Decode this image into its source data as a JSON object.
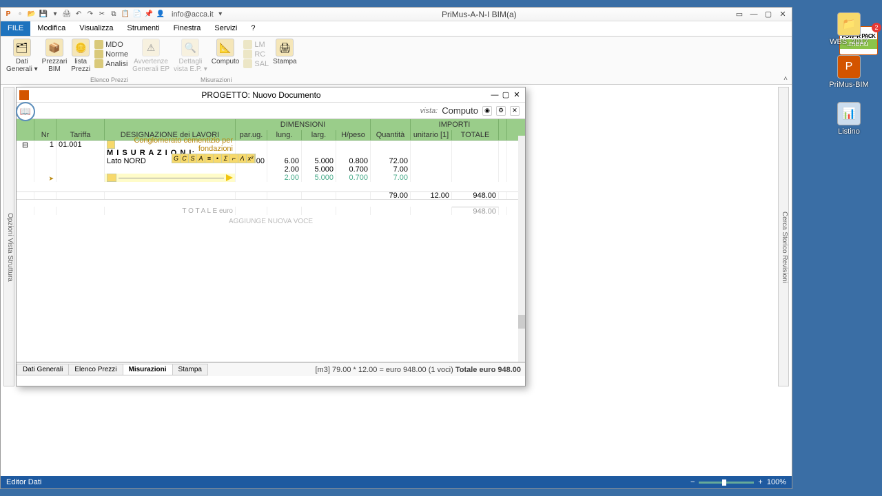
{
  "app_title": "PriMus-A-N-I    BIM(a)",
  "user_email": "info@acca.it",
  "qat_icons": [
    "app",
    "new",
    "open",
    "save",
    "sep",
    "print",
    "undo",
    "redo",
    "cut",
    "copy",
    "paste",
    "paste2",
    "help"
  ],
  "menus": [
    "FILE",
    "Modifica",
    "Visualizza",
    "Strumenti",
    "Finestra",
    "Servizi",
    "?"
  ],
  "ribbon_items": [
    {
      "label": "Dati\nGenerali ▾",
      "disabled": false
    },
    {
      "label": "Prezzari\nBIM",
      "disabled": false
    },
    {
      "label": "lista\nPrezzi",
      "disabled": false
    }
  ],
  "ribbon_stack1": [
    {
      "label": "MDO"
    },
    {
      "label": "Norme"
    },
    {
      "label": "Analisi"
    }
  ],
  "ribbon_group1": "Elenco Prezzi",
  "ribbon_items2": [
    {
      "label": "Avvertenze\nGenerali EP",
      "disabled": true
    },
    {
      "label": "Dettagli\nvista E.P. ▾",
      "disabled": true
    }
  ],
  "ribbon_items3": [
    {
      "label": "Computo",
      "disabled": false
    }
  ],
  "ribbon_stack2": [
    {
      "label": "LM",
      "disabled": true
    },
    {
      "label": "RC",
      "disabled": true
    },
    {
      "label": "SAL",
      "disabled": true
    }
  ],
  "ribbon_group2": "Misurazioni",
  "ribbon_items4": [
    {
      "label": "Stampa",
      "disabled": false
    }
  ],
  "powerpack": {
    "brand": "POW=R\nPACK",
    "menu": "menu",
    "badge": "2"
  },
  "project": {
    "title": "PROGETTO: Nuovo Documento",
    "vista_label": "vista:",
    "vista_value": "Computo",
    "columns_top": {
      "dim": "DIMENSIONI",
      "imp": "IMPORTI"
    },
    "columns": [
      "",
      "Nr",
      "Tariffa",
      "DESIGNAZIONE dei LAVORI",
      "par.ug.",
      "lung.",
      "larg.",
      "H/peso",
      "Quantità",
      "unitario [1]",
      "TOTALE"
    ],
    "item": {
      "nr": "1",
      "tariffa": "01.001",
      "desc": "Conglomerato cementizio per fondazioni",
      "mis": "M I S U R A Z I O N I:",
      "rows": [
        {
          "desc": "Lato NORD",
          "pu": "3.00",
          "lun": "6.00",
          "lar": "5.000",
          "hp": "0.800",
          "q": "72.00"
        },
        {
          "desc": "",
          "pu": "",
          "lun": "2.00",
          "lar": "5.000",
          "hp": "0.700",
          "q": "7.00"
        },
        {
          "desc": "",
          "pu": "",
          "lun": "2.00",
          "lar": "5.000",
          "hp": "0.700",
          "q": "7.00",
          "muted": true
        }
      ],
      "subtotal": {
        "q": "79.00",
        "uni": "12.00",
        "tot": "948.00"
      },
      "totale_label": "T O T A L E   euro",
      "grand_total": "948.00"
    },
    "add_voce": "AGGIUNGE NUOVA VOCE",
    "tabs": [
      "Dati Generali",
      "Elenco Prezzi",
      "Misurazioni",
      "Stampa"
    ],
    "active_tab": "Misurazioni",
    "status": "[m3] 79.00 * 12.00 = euro 948.00    (1 voci)  ",
    "status_totale": "Totale   euro   948.00"
  },
  "statusbar": {
    "text": "Editor Dati",
    "zoom": "100%"
  },
  "side_labels": {
    "left": "Opzioni Vista   Struttura",
    "right": "Cerca   Storico Revisioni"
  },
  "desktop": [
    {
      "label": "WBS_2017"
    },
    {
      "label": "PriMus-BIM"
    },
    {
      "label": "Listino"
    }
  ],
  "fmtbar": [
    "G",
    "C",
    "S",
    "A",
    "≡",
    "•",
    "Σ",
    "⌐",
    "Λ",
    "x²"
  ]
}
